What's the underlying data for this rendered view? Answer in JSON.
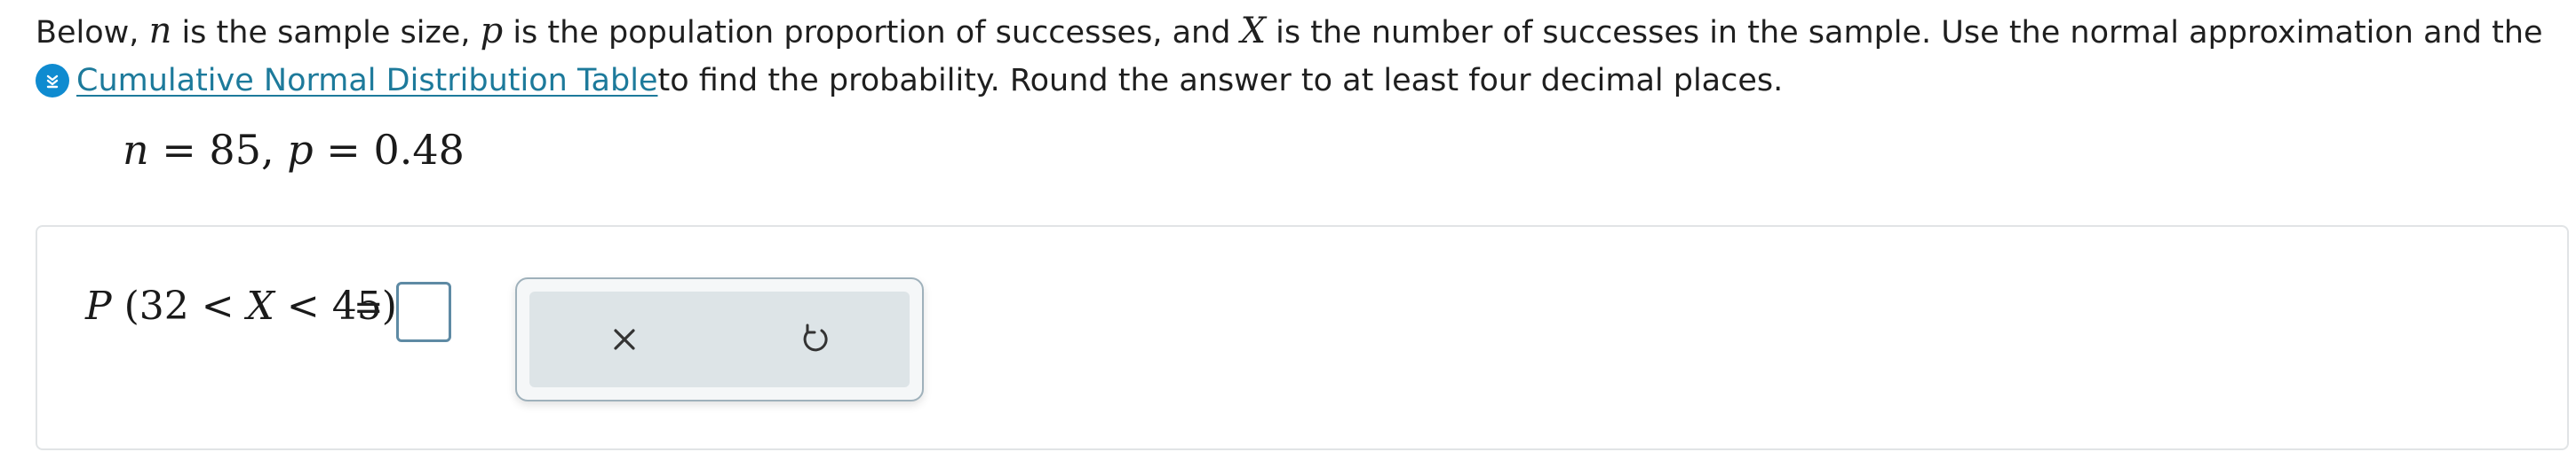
{
  "intro": {
    "part1": "Below, ",
    "var_n": "n",
    "part2": " is the sample size, ",
    "var_p": "p",
    "part3": " is the population proportion of successes, and ",
    "var_x": "X",
    "part4": " is the number of successes in the sample. Use the normal approximation and the",
    "link_text": "Cumulative Normal Distribution Table",
    "part5": " to find the probability. Round the answer to at least four decimal places."
  },
  "given": {
    "n_var": "n",
    "n_rest": " = 85, ",
    "p_var": "p",
    "p_rest": " = 0.48"
  },
  "question": {
    "p_var": "P",
    "open": " (32 < ",
    "x_var": "X",
    "close": " < 45)",
    "equals": "=",
    "answer_value": ""
  },
  "toolbar": {
    "clear_icon": "close-icon",
    "undo_icon": "undo-icon"
  },
  "colors": {
    "link": "#1d7a9b",
    "tool_icon_bg": "#0f8bd0",
    "answer_border": "#5e8aa4",
    "toolbar_bg": "#dde4e7"
  }
}
